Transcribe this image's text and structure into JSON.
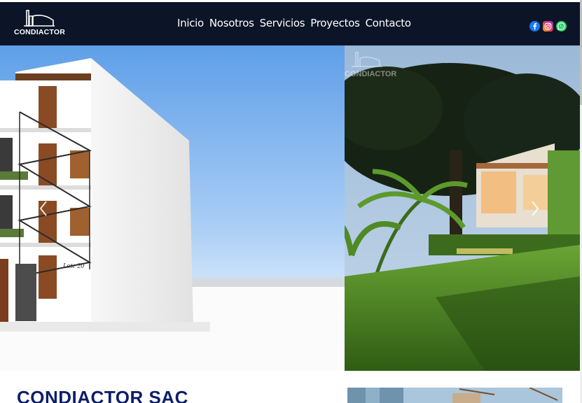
{
  "brand": {
    "name": "CONDIACTOR",
    "watermark": "CONDIACTOR"
  },
  "nav": {
    "items": [
      {
        "label": "Inicio"
      },
      {
        "label": "Nosotros"
      },
      {
        "label": "Servicios"
      },
      {
        "label": "Proyectos"
      },
      {
        "label": "Contacto"
      }
    ]
  },
  "socials": [
    {
      "icon": "facebook-icon",
      "color": "#1877f2"
    },
    {
      "icon": "instagram-icon",
      "color": "#d6249f"
    },
    {
      "icon": "whatsapp-icon",
      "color": "#25d366"
    }
  ],
  "carousel": {
    "slide_left": {
      "sign": "Lote 20"
    }
  },
  "company": {
    "heading": "CONDIACTOR SAC"
  },
  "colors": {
    "navbar": "#0b1527",
    "heading": "#0e1e6b"
  }
}
